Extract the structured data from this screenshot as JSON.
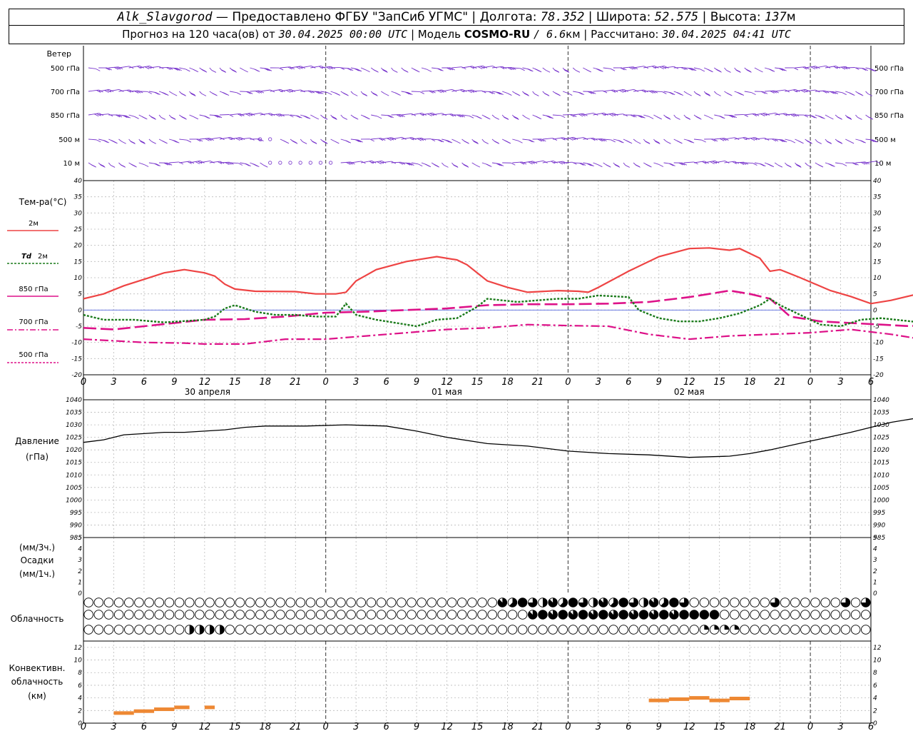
{
  "header": {
    "station": "Alk_Slavgorod",
    "provider": "— Предоставлено ФГБУ \"ЗапСиб УГМС\" |",
    "lon_label": "Долгота:",
    "lon": "78.352",
    "lat_label": "| Широта:",
    "lat": "52.575",
    "alt_label": "| Высота:",
    "alt": "137",
    "alt_unit": "м",
    "forecast_label": "Прогноз на 120 часа(ов) от",
    "forecast_time": "30.04.2025 00:00 UTC",
    "model_label": "| Модель",
    "model": "COSMO-RU",
    "resolution": "/ 6.6",
    "resolution_unit": "км |",
    "computed_label": "Рассчитано:",
    "computed_time": "30.04.2025 04:41 UTC"
  },
  "labels": {
    "wind": "Ветер",
    "wind_levels": [
      "500 гПа",
      "700 гПа",
      "850 гПа",
      "500 м",
      "10 м"
    ],
    "temp_title": "Тем-ра(°C)",
    "temp_2m": "2м",
    "td_2m_a": "Td",
    "td_2m_b": "2м",
    "t850": "850 гПа",
    "t700": "700 гПа",
    "t500": "500 гПа",
    "pressure_a": "Давление",
    "pressure_b": "(гПа)",
    "precip_a": "(мм/3ч.)",
    "precip_b": "Осадки",
    "precip_c": "(мм/1ч.)",
    "cloud": "Облачность",
    "conv_a": "Конвективн.",
    "conv_b": "облачность",
    "conv_c": "(км)",
    "days": [
      "30 апреля",
      "01 мая",
      "02 мая"
    ]
  },
  "colors": {
    "t2m": "#ee4444",
    "td2m": "#1a7a1a",
    "upper": "#dd1188",
    "wind": "#7733cc",
    "conv": "#ee8833",
    "pressure": "#000000"
  },
  "chart_data": {
    "type": "line",
    "x_hours": [
      0,
      3,
      6,
      9,
      12,
      15,
      18,
      21,
      24,
      27,
      30,
      33,
      36,
      39,
      42,
      45,
      48,
      51,
      54,
      57,
      60,
      63,
      66,
      69,
      72,
      75,
      78
    ],
    "x_tick_labels": [
      "0",
      "3",
      "6",
      "9",
      "12",
      "15",
      "18",
      "21",
      "0",
      "3",
      "6",
      "9",
      "12",
      "15",
      "18",
      "21",
      "0",
      "3",
      "6",
      "9",
      "12",
      "15",
      "18",
      "21",
      "0",
      "3",
      "6"
    ],
    "temperature": {
      "ylim": [
        -20,
        40
      ],
      "y_ticks": [
        -20,
        -15,
        -10,
        -5,
        0,
        5,
        10,
        15,
        20,
        25,
        30,
        35,
        40
      ],
      "t2m": [
        [
          0,
          3.5
        ],
        [
          2,
          5
        ],
        [
          4,
          7.5
        ],
        [
          6,
          9.5
        ],
        [
          8,
          11.5
        ],
        [
          10,
          12.5
        ],
        [
          12,
          11.5
        ],
        [
          13,
          10.5
        ],
        [
          14,
          8
        ],
        [
          15,
          6.5
        ],
        [
          17,
          5.8
        ],
        [
          21,
          5.7
        ],
        [
          23,
          5
        ],
        [
          25,
          5
        ],
        [
          26,
          5.5
        ],
        [
          27,
          9
        ],
        [
          29,
          12.5
        ],
        [
          32,
          15
        ],
        [
          35,
          16.5
        ],
        [
          37,
          15.5
        ],
        [
          38,
          14
        ],
        [
          40,
          9
        ],
        [
          42,
          7
        ],
        [
          44,
          5.5
        ],
        [
          47,
          6
        ],
        [
          49,
          5.8
        ],
        [
          50,
          5.5
        ],
        [
          51,
          7
        ],
        [
          54,
          12
        ],
        [
          57,
          16.5
        ],
        [
          60,
          19
        ],
        [
          62,
          19.2
        ],
        [
          64,
          18.5
        ],
        [
          65,
          19
        ],
        [
          67,
          16
        ],
        [
          68,
          12
        ],
        [
          69,
          12.5
        ],
        [
          71,
          10
        ],
        [
          74,
          6
        ],
        [
          76,
          4.2
        ],
        [
          78,
          2
        ],
        [
          80,
          3
        ],
        [
          84,
          6
        ],
        [
          87,
          9
        ]
      ],
      "td2m": [
        [
          0,
          -1.5
        ],
        [
          2,
          -3
        ],
        [
          5,
          -3
        ],
        [
          8,
          -3.8
        ],
        [
          12,
          -3
        ],
        [
          13,
          -2
        ],
        [
          14,
          0.5
        ],
        [
          15,
          1.5
        ],
        [
          17,
          -0.5
        ],
        [
          19,
          -1.5
        ],
        [
          21,
          -1.5
        ],
        [
          23,
          -2
        ],
        [
          25,
          -2
        ],
        [
          26,
          2
        ],
        [
          27,
          -1.5
        ],
        [
          29,
          -3
        ],
        [
          33,
          -5
        ],
        [
          35,
          -3
        ],
        [
          37,
          -2.5
        ],
        [
          39,
          1
        ],
        [
          40,
          3.5
        ],
        [
          43,
          2.5
        ],
        [
          45,
          3
        ],
        [
          47,
          3.5
        ],
        [
          49,
          3.5
        ],
        [
          51,
          4.5
        ],
        [
          54,
          4
        ],
        [
          55,
          0
        ],
        [
          57,
          -2.5
        ],
        [
          59,
          -3.5
        ],
        [
          61,
          -3.5
        ],
        [
          63,
          -2.5
        ],
        [
          65,
          -1
        ],
        [
          67,
          1.5
        ],
        [
          68,
          3.5
        ],
        [
          69,
          1.5
        ],
        [
          71,
          -1.5
        ],
        [
          73,
          -4.5
        ],
        [
          75,
          -5
        ],
        [
          77,
          -3
        ],
        [
          79,
          -2.5
        ],
        [
          82,
          -3.5
        ],
        [
          84,
          -4.5
        ],
        [
          87,
          -6.8
        ]
      ],
      "t850": [
        [
          0,
          -5.5
        ],
        [
          3,
          -6
        ],
        [
          6,
          -5
        ],
        [
          9,
          -4
        ],
        [
          12,
          -3
        ],
        [
          16,
          -2.8
        ],
        [
          20,
          -2
        ],
        [
          24,
          -0.8
        ],
        [
          28,
          -0.5
        ],
        [
          32,
          0
        ],
        [
          36,
          0.5
        ],
        [
          40,
          1.5
        ],
        [
          44,
          1.8
        ],
        [
          48,
          1.8
        ],
        [
          52,
          2
        ],
        [
          56,
          2.5
        ],
        [
          60,
          4
        ],
        [
          62,
          5
        ],
        [
          64,
          6
        ],
        [
          66,
          5
        ],
        [
          68,
          3.5
        ],
        [
          70,
          -2
        ],
        [
          73,
          -3.5
        ],
        [
          76,
          -4
        ],
        [
          79,
          -4.5
        ],
        [
          82,
          -5
        ],
        [
          85,
          -3.5
        ],
        [
          87,
          -3.5
        ]
      ],
      "t700": [
        [
          0,
          -9
        ],
        [
          3,
          -9.5
        ],
        [
          6,
          -10
        ],
        [
          10,
          -10.2
        ],
        [
          12,
          -10.5
        ],
        [
          16,
          -10.5
        ],
        [
          20,
          -9
        ],
        [
          24,
          -9
        ],
        [
          28,
          -8
        ],
        [
          32,
          -7
        ],
        [
          36,
          -6
        ],
        [
          40,
          -5.5
        ],
        [
          44,
          -4.5
        ],
        [
          48,
          -4.8
        ],
        [
          52,
          -5
        ],
        [
          56,
          -7.5
        ],
        [
          60,
          -9
        ],
        [
          64,
          -8
        ],
        [
          68,
          -7.5
        ],
        [
          72,
          -7
        ],
        [
          76,
          -6
        ],
        [
          80,
          -7.5
        ],
        [
          84,
          -9.5
        ],
        [
          87,
          -9
        ]
      ],
      "t500_note": "500 hPa curve not distinguishable in image"
    },
    "pressure": {
      "ylim": [
        985,
        1040
      ],
      "y_ticks": [
        985,
        990,
        995,
        1000,
        1005,
        1010,
        1015,
        1020,
        1025,
        1030,
        1035,
        1040
      ],
      "series": [
        [
          0,
          1023
        ],
        [
          2,
          1024
        ],
        [
          4,
          1026
        ],
        [
          6,
          1026.5
        ],
        [
          8,
          1027
        ],
        [
          10,
          1027
        ],
        [
          12,
          1027.5
        ],
        [
          14,
          1028
        ],
        [
          16,
          1029
        ],
        [
          18,
          1029.5
        ],
        [
          22,
          1029.5
        ],
        [
          26,
          1030
        ],
        [
          30,
          1029.5
        ],
        [
          33,
          1027.5
        ],
        [
          36,
          1025
        ],
        [
          40,
          1022.5
        ],
        [
          44,
          1021.5
        ],
        [
          48,
          1019.5
        ],
        [
          52,
          1018.5
        ],
        [
          56,
          1018
        ],
        [
          60,
          1017
        ],
        [
          64,
          1017.5
        ],
        [
          66,
          1018.5
        ],
        [
          68,
          1020
        ],
        [
          72,
          1023.5
        ],
        [
          76,
          1027
        ],
        [
          80,
          1031
        ],
        [
          83,
          1033
        ],
        [
          85,
          1032.5
        ],
        [
          87,
          1032.5
        ]
      ]
    },
    "precipitation": {
      "ylim": [
        0,
        5
      ],
      "y_ticks": [
        0,
        1,
        2,
        3,
        4,
        5
      ],
      "values": []
    },
    "convective_cloud": {
      "ylim": [
        0,
        13
      ],
      "y_ticks": [
        0,
        2,
        4,
        6,
        8,
        10,
        12
      ],
      "segments": [
        [
          3,
          5,
          1.6
        ],
        [
          5,
          7,
          1.9
        ],
        [
          7,
          9,
          2.2
        ],
        [
          9,
          10.5,
          2.5
        ],
        [
          12,
          13,
          2.5
        ],
        [
          56,
          58,
          3.6
        ],
        [
          58,
          60,
          3.8
        ],
        [
          60,
          62,
          4
        ],
        [
          62,
          64,
          3.6
        ],
        [
          64,
          66,
          3.9
        ]
      ]
    },
    "cloud_rows_note": "three rows of cloud-cover octant circles, 78 per row"
  }
}
